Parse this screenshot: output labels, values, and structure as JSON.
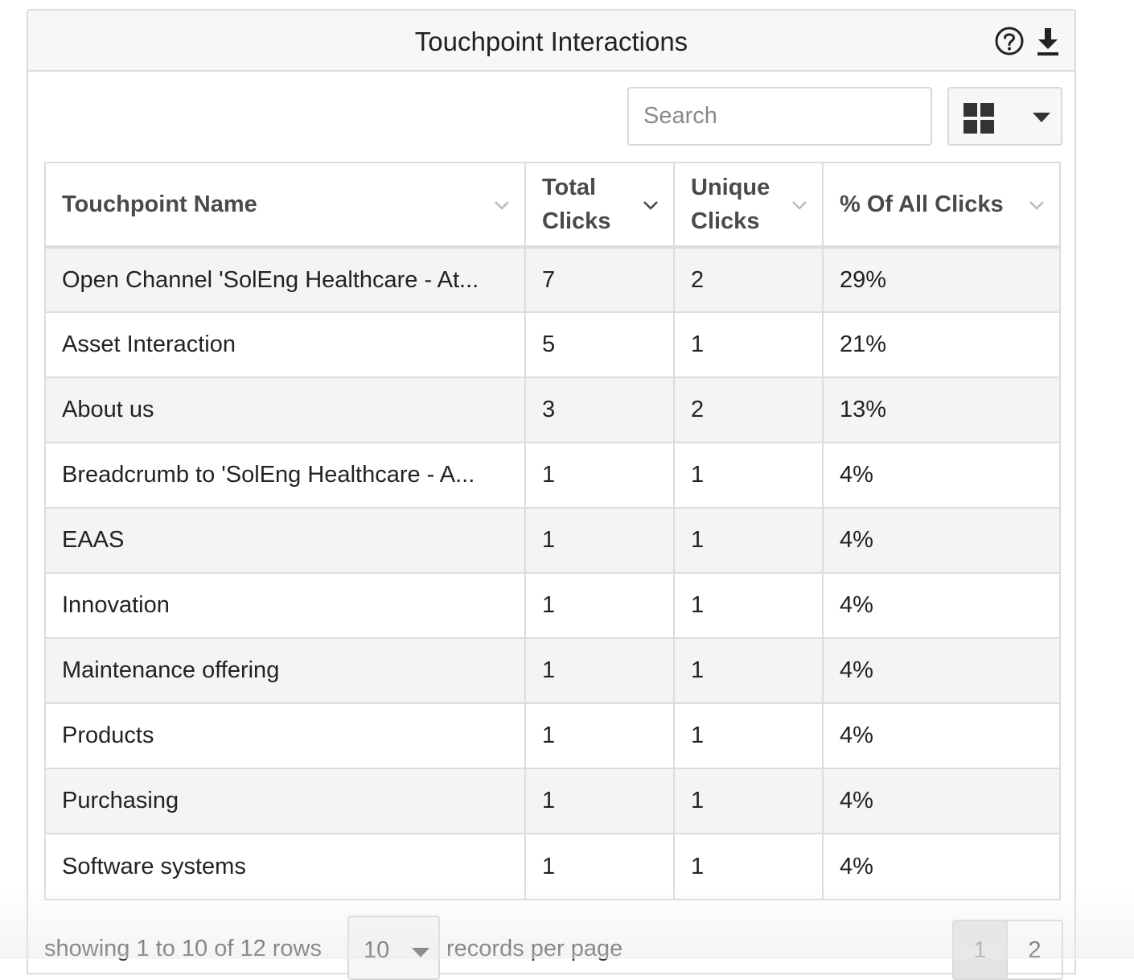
{
  "panel": {
    "title": "Touchpoint Interactions",
    "icons": {
      "help": "help-circle-icon",
      "download": "download-icon"
    }
  },
  "toolbar": {
    "search_placeholder": "Search",
    "columns_icon": "grid-icon",
    "columns_dropdown_icon": "caret-down-icon"
  },
  "table": {
    "columns": [
      {
        "label": "Touchpoint Name",
        "sort_icon": "chevron-down-icon"
      },
      {
        "label": "Total Clicks",
        "sort_icon": "chevron-down-icon",
        "sorted": true
      },
      {
        "label": "Unique Clicks",
        "sort_icon": "chevron-down-icon"
      },
      {
        "label": "% Of All Clicks",
        "sort_icon": "chevron-down-icon"
      }
    ],
    "rows": [
      {
        "name": "Open Channel 'SolEng Healthcare - At...",
        "total": "7",
        "unique": "2",
        "percent": "29%"
      },
      {
        "name": "Asset Interaction",
        "total": "5",
        "unique": "1",
        "percent": "21%"
      },
      {
        "name": "About us",
        "total": "3",
        "unique": "2",
        "percent": "13%"
      },
      {
        "name": "Breadcrumb to 'SolEng Healthcare - A...",
        "total": "1",
        "unique": "1",
        "percent": "4%"
      },
      {
        "name": "EAAS",
        "total": "1",
        "unique": "1",
        "percent": "4%"
      },
      {
        "name": "Innovation",
        "total": "1",
        "unique": "1",
        "percent": "4%"
      },
      {
        "name": "Maintenance offering",
        "total": "1",
        "unique": "1",
        "percent": "4%"
      },
      {
        "name": "Products",
        "total": "1",
        "unique": "1",
        "percent": "4%"
      },
      {
        "name": "Purchasing",
        "total": "1",
        "unique": "1",
        "percent": "4%"
      },
      {
        "name": "Software systems",
        "total": "1",
        "unique": "1",
        "percent": "4%"
      }
    ]
  },
  "footer": {
    "showing_text": "showing 1 to 10 of 12 rows",
    "page_size_value": "10",
    "records_text": "records per page",
    "pages": [
      "1",
      "2"
    ],
    "current_page": "1"
  },
  "colors": {
    "border": "#dcdcdc",
    "header_bg": "#f7f7f7",
    "stripe_bg": "#f4f4f4",
    "active_page_bg": "#e4e4e4"
  }
}
